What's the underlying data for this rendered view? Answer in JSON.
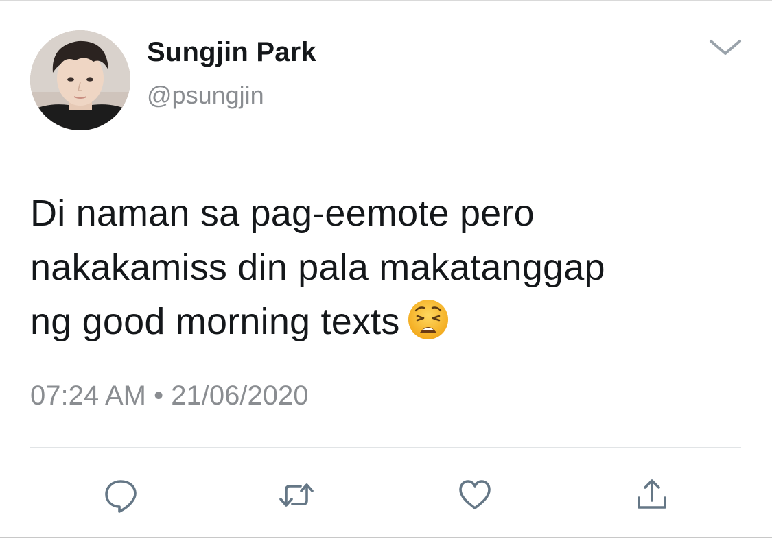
{
  "tweet": {
    "display_name": "Sungjin Park",
    "handle": "@psungjin",
    "text_lines": [
      "Di naman sa pag-eemote pero",
      "nakakamiss din pala makatanggap",
      "ng good morning texts"
    ],
    "emoji": "weary-face",
    "time": "07:24 AM",
    "separator": "•",
    "date": "21/06/2020"
  },
  "actions": [
    {
      "icon": "reply-icon"
    },
    {
      "icon": "retweet-icon"
    },
    {
      "icon": "like-icon"
    },
    {
      "icon": "share-icon"
    }
  ],
  "colors": {
    "text": "#14171a",
    "secondary": "#8a8d91",
    "icon": "#657786",
    "divider": "#e1e4e6"
  }
}
